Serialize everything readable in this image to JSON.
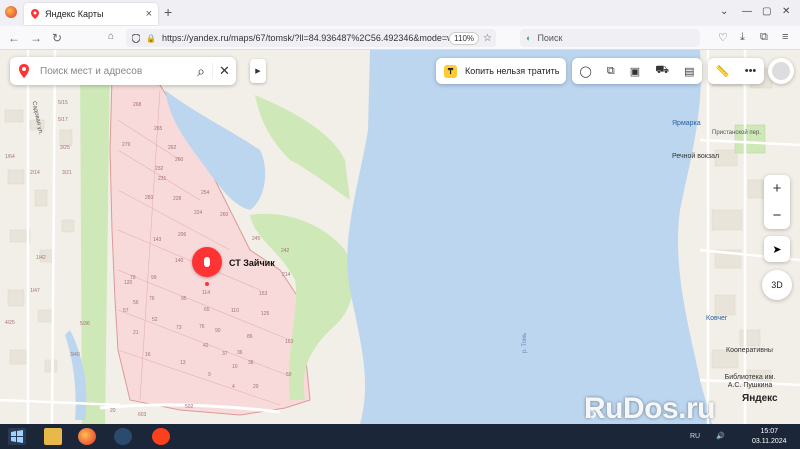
{
  "browser": {
    "tab_title": "Яндекс Карты",
    "url": "https://yandex.ru/maps/67/tomsk/?ll=84.936487%2C56.492346&mode=what",
    "zoom": "110%",
    "search_placeholder": "Поиск"
  },
  "map_ui": {
    "search_placeholder": "Поиск мест и адресов",
    "promo_label": "Копить нельзя тратить",
    "promo_icon_glyph": "₸",
    "zoom_in": "+",
    "zoom_out": "−",
    "btn_3d": "3D",
    "yandex_logo": "Яндекс",
    "place_name": "СТ Зайчик"
  },
  "map_labels": {
    "street_sadovaya": "Садовая ул.",
    "yarmarka": "Ярмарка",
    "pristanskoy": "Пристанской пер.",
    "rechnoy": "Речной вокзал",
    "kovcheg": "Ковчег",
    "kooperativny": "Кооперативны",
    "library": "Библиотека им. А.С. Пушкина",
    "river": "р. Томь",
    "house_numbers": [
      "5/15",
      "5/17",
      "1/64",
      "2/14",
      "3/25",
      "3/21",
      "1/42",
      "1/47",
      "4/25",
      "3/40",
      "5/36",
      "20",
      "603",
      "502",
      "268",
      "265",
      "279",
      "262",
      "260",
      "232",
      "231",
      "283",
      "228",
      "254",
      "224",
      "260",
      "143",
      "296",
      "245",
      "242",
      "140",
      "214",
      "120",
      "114",
      "153",
      "110",
      "99",
      "76",
      "95",
      "90",
      "125",
      "57",
      "65",
      "52",
      "73",
      "21",
      "76",
      "42",
      "37",
      "163",
      "16",
      "13",
      "9",
      "4",
      "29",
      "59",
      "38",
      "56",
      "79",
      "36",
      "10",
      "86"
    ]
  },
  "watermark": "RuDos.ru",
  "taskbar": {
    "lang": "RU",
    "time": "15:07",
    "date": "03.11.2024"
  },
  "colors": {
    "water": "#bcd6f0",
    "park": "#cfe8b8",
    "plot": "#f9dada",
    "plot_border": "#d99",
    "marker": "#ff3333"
  }
}
